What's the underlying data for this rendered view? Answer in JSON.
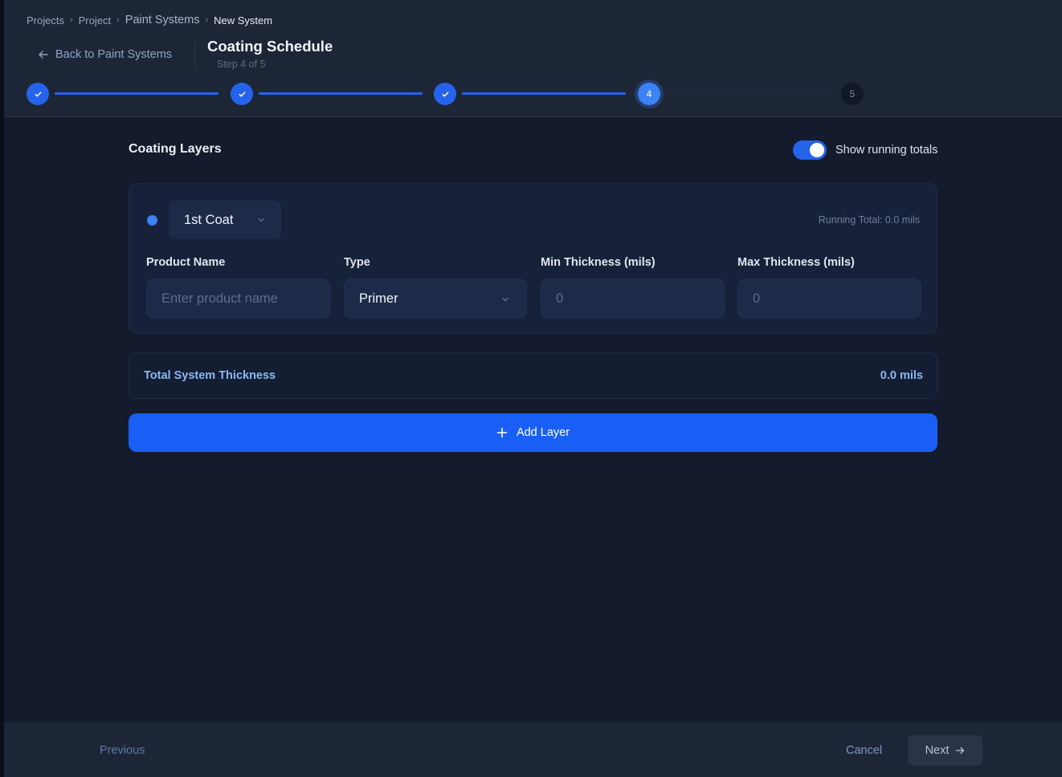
{
  "breadcrumb": {
    "items": [
      "Projects",
      "Project",
      "Paint Systems",
      "New System"
    ],
    "separator": "›"
  },
  "header": {
    "back_label": "Back to Paint Systems",
    "title": "Coating Schedule",
    "subtitle": "Step 4 of 5"
  },
  "stepper": {
    "current": 4,
    "total": 5,
    "steps": [
      {
        "state": "done",
        "label": ""
      },
      {
        "state": "done",
        "label": ""
      },
      {
        "state": "done",
        "label": ""
      },
      {
        "state": "active",
        "label": "4"
      },
      {
        "state": "todo",
        "label": "5"
      }
    ]
  },
  "section": {
    "title": "Coating Layers",
    "toggle_label": "Show running totals",
    "toggle_on": true
  },
  "layer": {
    "coat": "1st Coat",
    "running_total": "Running Total: 0.0 mils",
    "fields": {
      "product_label": "Product Name",
      "product_placeholder": "Enter product name",
      "type_label": "Type",
      "type_value": "Primer",
      "min_label": "Min Thickness (mils)",
      "min_placeholder": "0",
      "max_label": "Max Thickness (mils)",
      "max_placeholder": "0"
    }
  },
  "total": {
    "label": "Total System Thickness",
    "value": "0.0 mils"
  },
  "add_layer_label": "Add Layer",
  "footer": {
    "previous": "Previous",
    "cancel": "Cancel",
    "next": "Next"
  },
  "colors": {
    "accent": "#2563eb",
    "button": "#1a5ff5",
    "background": "#131b2c",
    "header": "#1d2637"
  }
}
